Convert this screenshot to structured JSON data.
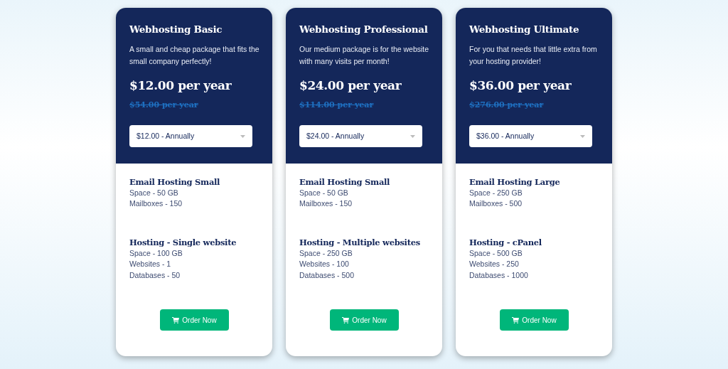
{
  "plans": [
    {
      "title": "Webhosting Basic",
      "description": "A small and cheap package that fits the small company perfectly!",
      "price": "$12.00 per year",
      "old_price": "$54.00 per year",
      "billing": "$12.00 - Annually",
      "features": [
        {
          "title": "Email Hosting Small",
          "lines": [
            "Space - 50 GB",
            "Mailboxes - 150"
          ]
        },
        {
          "title": "Hosting - Single website",
          "lines": [
            "Space - 100 GB",
            "Websites - 1",
            "Databases - 50"
          ]
        }
      ],
      "button": "Order Now"
    },
    {
      "title": "Webhosting Professional",
      "description": "Our medium package is for the website with many visits per month!",
      "price": "$24.00 per year",
      "old_price": "$114.00 per year",
      "billing": "$24.00 - Annually",
      "features": [
        {
          "title": "Email Hosting Small",
          "lines": [
            "Space - 50 GB",
            "Mailboxes - 150"
          ]
        },
        {
          "title": "Hosting - Multiple websites",
          "lines": [
            "Space - 250 GB",
            "Websites - 100",
            "Databases - 500"
          ]
        }
      ],
      "button": "Order Now"
    },
    {
      "title": "Webhosting Ultimate",
      "description": "For you that needs that little extra from your hosting provider!",
      "price": "$36.00 per year",
      "old_price": "$276.00 per year",
      "billing": "$36.00 - Annually",
      "features": [
        {
          "title": "Email Hosting Large",
          "lines": [
            "Space - 250 GB",
            "Mailboxes - 500"
          ]
        },
        {
          "title": "Hosting - cPanel",
          "lines": [
            "Space - 500 GB",
            "Websites - 250",
            "Databases - 1000"
          ]
        }
      ],
      "button": "Order Now"
    }
  ]
}
